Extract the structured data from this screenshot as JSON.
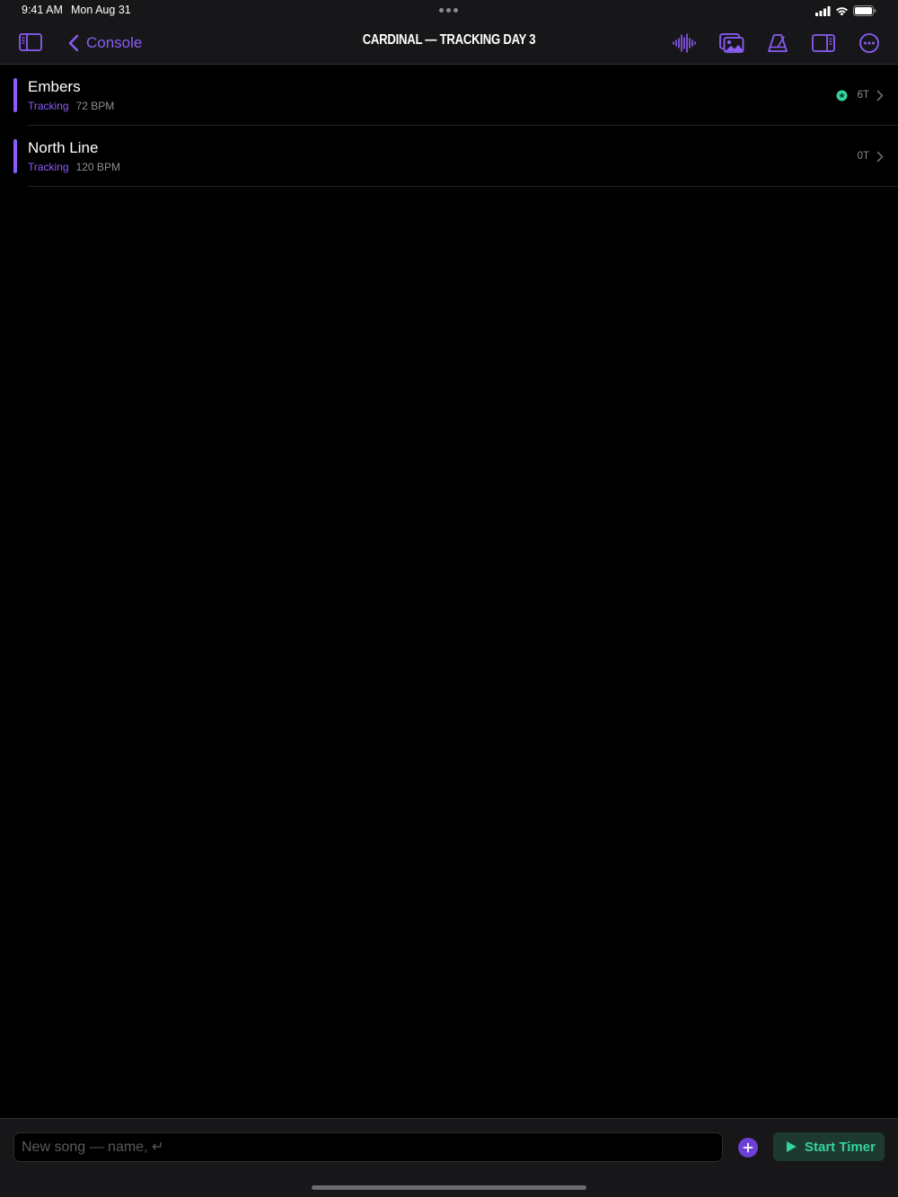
{
  "status_bar": {
    "time": "9:41 AM",
    "date": "Mon Aug 31"
  },
  "nav": {
    "back_label": "Console",
    "title": "CARDINAL — TRACKING DAY 3",
    "icons": [
      "sidebar-icon",
      "waveform-icon",
      "photo-library-icon",
      "metronome-icon",
      "inspector-panel-icon",
      "more-icon"
    ]
  },
  "songs": [
    {
      "title": "Embers",
      "status": "Tracking",
      "bpm": "72 BPM",
      "takes": "6T",
      "has_badge": true
    },
    {
      "title": "North Line",
      "status": "Tracking",
      "bpm": "120 BPM",
      "takes": "0T",
      "has_badge": false
    }
  ],
  "bottom": {
    "input_placeholder": "New song — name, ↵",
    "timer_label": "Start Timer"
  },
  "colors": {
    "accent": "#8b5cf6",
    "success": "#34d399",
    "background": "#000000",
    "bar": "#171719"
  }
}
